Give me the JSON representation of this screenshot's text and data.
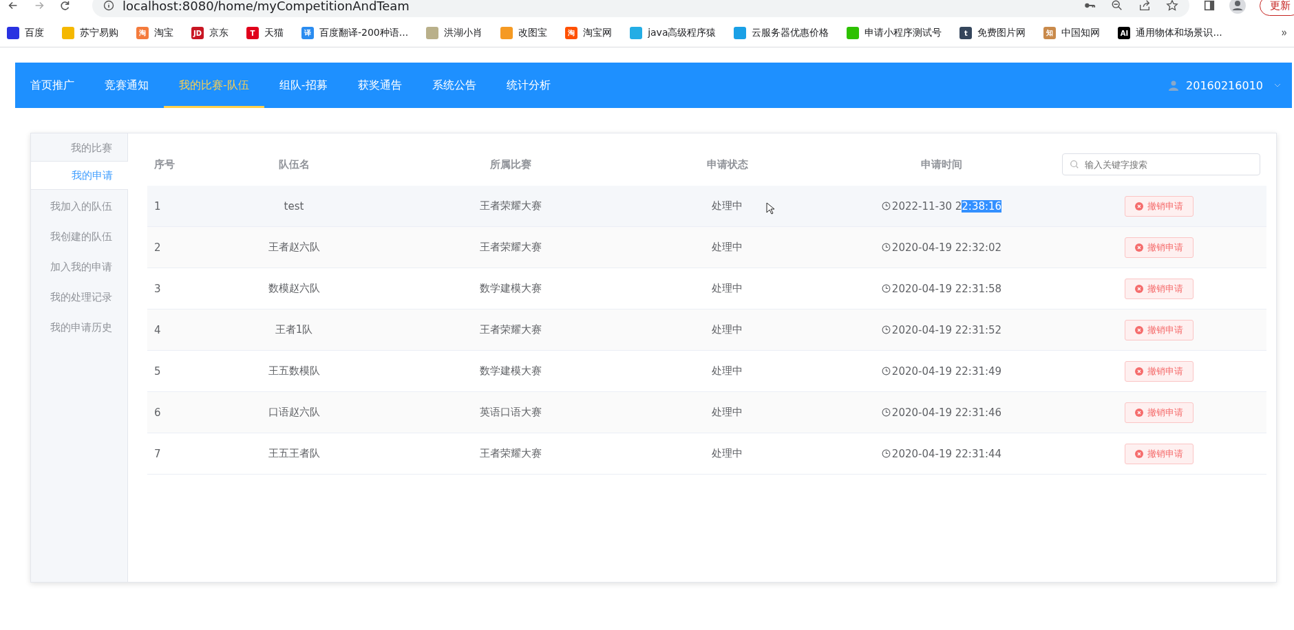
{
  "browser": {
    "url": "localhost:8080/home/myCompetitionAndTeam",
    "update_button": "更新",
    "bookmarks": [
      {
        "label": "百度",
        "color": "#2932e1"
      },
      {
        "label": "苏宁易购",
        "color": "#f5b800"
      },
      {
        "label": "淘宝",
        "color": "#f47b3c",
        "icon_text": "淘"
      },
      {
        "label": "京东",
        "color": "#c81623",
        "icon_text": "JD"
      },
      {
        "label": "天猫",
        "color": "#e0001b",
        "icon_text": "T"
      },
      {
        "label": "百度翻译-200种语...",
        "color": "#2a8cf0",
        "icon_text": "译"
      },
      {
        "label": "洪湖小肖",
        "color": "#b9b08a"
      },
      {
        "label": "改图宝",
        "color": "#f59a23"
      },
      {
        "label": "淘宝网",
        "color": "#ff5000",
        "icon_text": "淘"
      },
      {
        "label": "java高级程序猿",
        "color": "#23ade5"
      },
      {
        "label": "云服务器优惠价格",
        "color": "#1aa0e6"
      },
      {
        "label": "申请小程序测试号",
        "color": "#2dc100"
      },
      {
        "label": "免费图片网",
        "color": "#35465c",
        "icon_text": "t"
      },
      {
        "label": "中国知网",
        "color": "#c98a4b",
        "icon_text": "知"
      },
      {
        "label": "通用物体和场景识...",
        "color": "#000000",
        "icon_text": "AI"
      }
    ]
  },
  "nav": {
    "items": [
      {
        "label": "首页推广",
        "selected": false
      },
      {
        "label": "竞赛通知",
        "selected": false
      },
      {
        "label": "我的比赛-队伍",
        "selected": true
      },
      {
        "label": "组队-招募",
        "selected": false
      },
      {
        "label": "获奖通告",
        "selected": false
      },
      {
        "label": "系统公告",
        "selected": false
      },
      {
        "label": "统计分析",
        "selected": false
      }
    ],
    "user": "20160216010"
  },
  "sidebar": {
    "items": [
      {
        "label": "我的比赛",
        "selected": false
      },
      {
        "label": "我的申请",
        "selected": true
      },
      {
        "label": "我加入的队伍",
        "selected": false
      },
      {
        "label": "我创建的队伍",
        "selected": false
      },
      {
        "label": "加入我的申请",
        "selected": false
      },
      {
        "label": "我的处理记录",
        "selected": false
      },
      {
        "label": "我的申请历史",
        "selected": false
      }
    ]
  },
  "table": {
    "columns": [
      "序号",
      "队伍名",
      "所属比赛",
      "申请状态",
      "申请时间"
    ],
    "search": {
      "placeholder": "输入关键字搜索"
    },
    "rows": [
      {
        "index": "1",
        "team": "test",
        "competition": "王者荣耀大赛",
        "status": "处理中",
        "time": "2022-11-30 2",
        "time_highlight": "2:38:16",
        "hovered": true,
        "action": "撤销申请"
      },
      {
        "index": "2",
        "team": "王者赵六队",
        "competition": "王者荣耀大赛",
        "status": "处理中",
        "time": "2020-04-19 22:32:02",
        "hovered": false,
        "action": "撤销申请"
      },
      {
        "index": "3",
        "team": "数模赵六队",
        "competition": "数学建模大赛",
        "status": "处理中",
        "time": "2020-04-19 22:31:58",
        "hovered": false,
        "action": "撤销申请"
      },
      {
        "index": "4",
        "team": "王者1队",
        "competition": "王者荣耀大赛",
        "status": "处理中",
        "time": "2020-04-19 22:31:52",
        "hovered": false,
        "action": "撤销申请"
      },
      {
        "index": "5",
        "team": "王五数模队",
        "competition": "数学建模大赛",
        "status": "处理中",
        "time": "2020-04-19 22:31:49",
        "hovered": false,
        "action": "撤销申请"
      },
      {
        "index": "6",
        "team": "口语赵六队",
        "competition": "英语口语大赛",
        "status": "处理中",
        "time": "2020-04-19 22:31:46",
        "hovered": false,
        "action": "撤销申请"
      },
      {
        "index": "7",
        "team": "王五王者队",
        "competition": "王者荣耀大赛",
        "status": "处理中",
        "time": "2020-04-19 22:31:44",
        "hovered": false,
        "action": "撤销申请"
      }
    ]
  }
}
